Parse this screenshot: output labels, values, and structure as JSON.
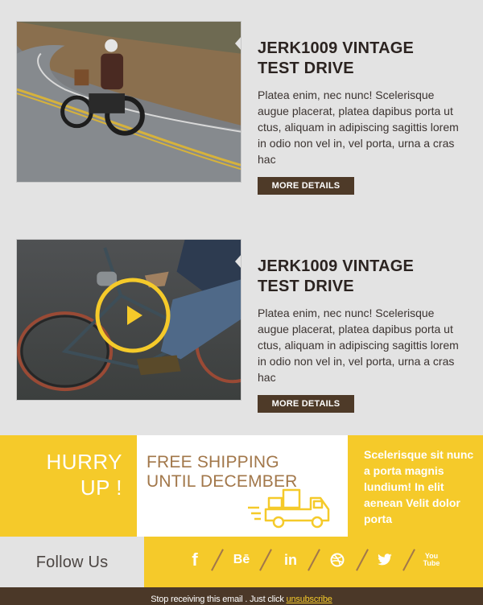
{
  "cards": [
    {
      "image_alt": "Rider on vintage motorcycle on winding road",
      "title_line1": "JERK1009 VINTAGE",
      "title_line2": "TEST DRIVE",
      "description": "Platea enim, nec nunc! Scelerisque augue placerat, platea dapibus porta ut ctus, aliquam in adipiscing sagittis lorem in odio non vel in, vel porta, urna a cras hac",
      "button_label": "MORE DETAILS"
    },
    {
      "image_alt": "Rider on vintage bicycle video",
      "title_line1": "JERK1009 VINTAGE",
      "title_line2": "TEST DRIVE",
      "description": "Platea enim, nec nunc! Scelerisque augue placerat, platea dapibus porta ut ctus, aliquam in adipiscing sagittis lorem in odio non vel in, vel porta, urna a cras hac",
      "button_label": "MORE DETAILS"
    }
  ],
  "promo": {
    "hurry_line1": "HURRY",
    "hurry_line2": "UP !",
    "shipping_line1": "FREE SHIPPING",
    "shipping_line2": "UNTIL DECEMBER",
    "side_text": "Scelerisque sit nunc a porta magnis lundium! In elit aenean Velit dolor porta"
  },
  "follow": {
    "label": "Follow Us",
    "icons": [
      "facebook-icon",
      "behance-icon",
      "linkedin-icon",
      "dribbble-icon",
      "twitter-icon",
      "youtube-icon"
    ],
    "behance_text": "Bē",
    "linkedin_text": "in",
    "youtube_text_1": "You",
    "youtube_text_2": "Tube",
    "facebook_text": "f"
  },
  "footer": {
    "text": "Stop receiving this email . Just click",
    "link": "unsubscribe"
  },
  "colors": {
    "accent_yellow": "#f5ca2a",
    "brown": "#4e3a28",
    "tan": "#a2774a",
    "background": "#e3e3e3"
  }
}
